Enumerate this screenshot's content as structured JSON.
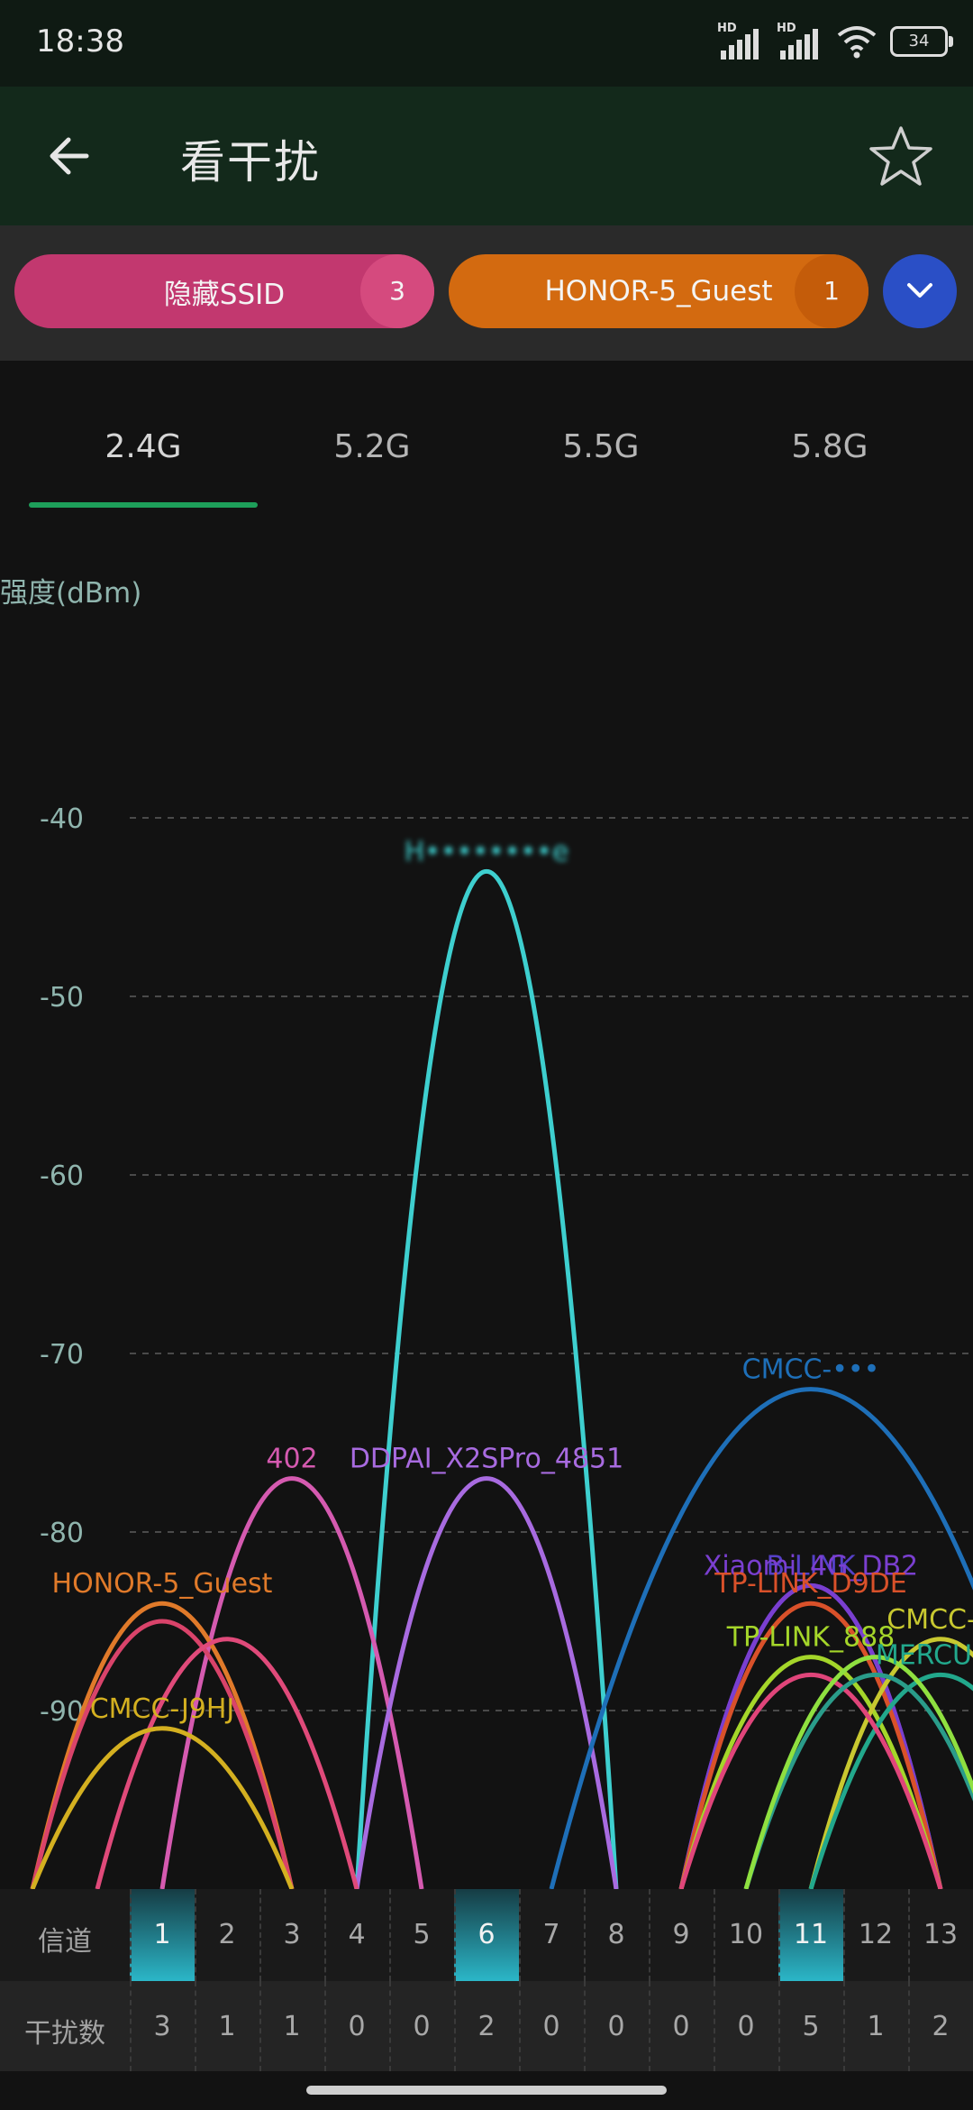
{
  "status_bar": {
    "time": "18:38",
    "battery": "34"
  },
  "app_bar": {
    "title": "看干扰"
  },
  "filters": [
    {
      "label": "隐藏SSID",
      "count": "3",
      "color": "#c2386f"
    },
    {
      "label": "HONOR-5_Guest",
      "count": "1",
      "color": "#d36a10"
    }
  ],
  "tabs": [
    "2.4G",
    "5.2G",
    "5.5G",
    "5.8G"
  ],
  "active_tab": "2.4G",
  "y_axis_title": "强度(dBm)",
  "table": {
    "channel_label": "信道",
    "interference_label": "干扰数",
    "channels": [
      "1",
      "2",
      "3",
      "4",
      "5",
      "6",
      "7",
      "8",
      "9",
      "10",
      "11",
      "12",
      "13"
    ],
    "interference": [
      "3",
      "1",
      "1",
      "0",
      "0",
      "2",
      "0",
      "0",
      "0",
      "0",
      "5",
      "1",
      "2"
    ],
    "highlighted_channels": [
      "1",
      "6",
      "11"
    ]
  },
  "chart_data": {
    "type": "line",
    "xlabel": "信道",
    "ylabel": "强度(dBm)",
    "y_ticks": [
      "-40",
      "-50",
      "-60",
      "-70",
      "-80",
      "-90"
    ],
    "ylim": [
      -100,
      -40
    ],
    "grid": true,
    "series": [
      {
        "name": "H••••••••e",
        "channel_center": 6,
        "width": 4,
        "peak": -43,
        "color": "#3ecfcf"
      },
      {
        "name": "402",
        "channel_center": 3,
        "width": 4,
        "peak": -77,
        "color": "#d55ab0"
      },
      {
        "name": "DDPAI_X2SPro_4851",
        "channel_center": 6,
        "width": 4,
        "peak": -77,
        "color": "#a86be0"
      },
      {
        "name": "HONOR-5_Guest",
        "channel_center": 1,
        "width": 4,
        "peak": -84,
        "color": "#e07a2a"
      },
      {
        "name": "",
        "channel_center": 1,
        "width": 4,
        "peak": -85,
        "color": "#d9436a"
      },
      {
        "name": "",
        "channel_center": 2,
        "width": 4,
        "peak": -86,
        "color": "#e04a7a"
      },
      {
        "name": "CMCC-J9HJ",
        "channel_center": 1,
        "width": 4,
        "peak": -91,
        "color": "#d4b020"
      },
      {
        "name": "CMCC-•••",
        "channel_center": 11,
        "width": 8,
        "peak": -72,
        "color": "#1e6fb8"
      },
      {
        "name": "B-LINK",
        "channel_center": 11,
        "width": 4,
        "peak": -83,
        "color": "#5540c8"
      },
      {
        "name": "Xiaomi_4G_DB2",
        "channel_center": 11,
        "width": 4,
        "peak": -83,
        "color": "#7a3fd0"
      },
      {
        "name": "TP-LINK_D9DE",
        "channel_center": 11,
        "width": 4,
        "peak": -84,
        "color": "#d9512a"
      },
      {
        "name": "TP-LINK_888",
        "channel_center": 11,
        "width": 4,
        "peak": -87,
        "color": "#a5d62a"
      },
      {
        "name": "CMCC-A",
        "channel_center": 13,
        "width": 4,
        "peak": -86,
        "color": "#c8c830"
      },
      {
        "name": "MERCURY",
        "channel_center": 13,
        "width": 4,
        "peak": -88,
        "color": "#22a88c"
      },
      {
        "name": "",
        "channel_center": 11,
        "width": 4,
        "peak": -88,
        "color": "#e0457a"
      },
      {
        "name": "",
        "channel_center": 12,
        "width": 4,
        "peak": -88,
        "color": "#2a9c8a"
      },
      {
        "name": "",
        "channel_center": 12,
        "width": 4,
        "peak": -87,
        "color": "#8fe040"
      }
    ]
  }
}
